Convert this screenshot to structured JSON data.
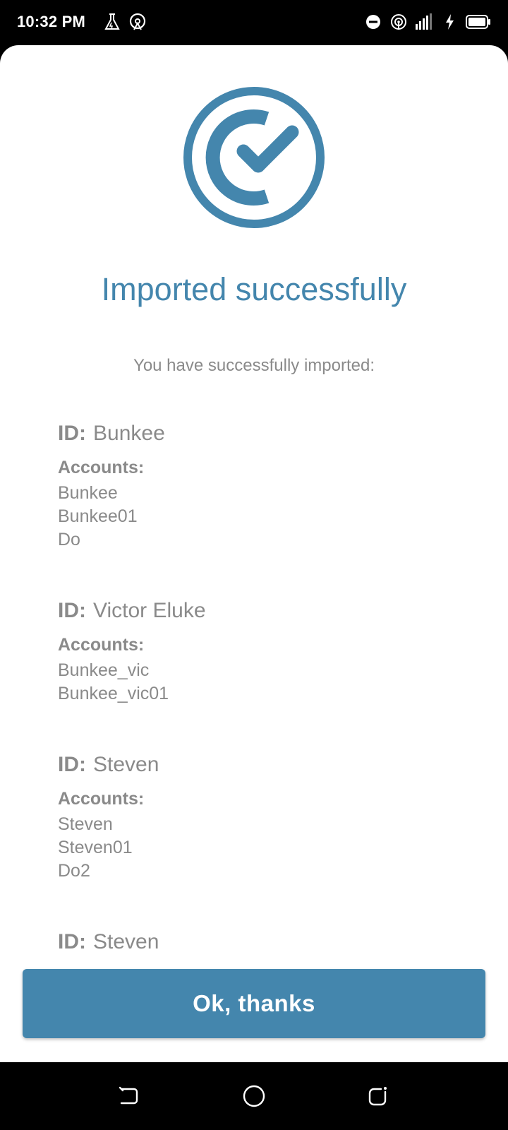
{
  "status_bar": {
    "time": "10:32 PM",
    "left_icons": [
      "flask-icon",
      "hotspot-icon"
    ],
    "right_icons": [
      "do-not-disturb-icon",
      "wifi-hotspot-icon",
      "signal-icon",
      "charging-icon",
      "battery-icon"
    ]
  },
  "dialog": {
    "title": "Imported successfully",
    "subtitle": "You have successfully imported:",
    "id_label": "ID:",
    "accounts_label": "Accounts:",
    "entries": [
      {
        "id": "Bunkee",
        "accounts": [
          "Bunkee",
          "Bunkee01",
          "Do"
        ]
      },
      {
        "id": "Victor Eluke",
        "accounts": [
          "Bunkee_vic",
          "Bunkee_vic01"
        ]
      },
      {
        "id": "Steven",
        "accounts": [
          "Steven",
          "Steven01",
          "Do2"
        ]
      },
      {
        "id": "Steven",
        "accounts": []
      }
    ],
    "button_label": "Ok, thanks",
    "accent_color": "#4486ad"
  },
  "nav_bar": {
    "buttons": [
      "back-icon",
      "home-icon",
      "recents-icon"
    ]
  }
}
